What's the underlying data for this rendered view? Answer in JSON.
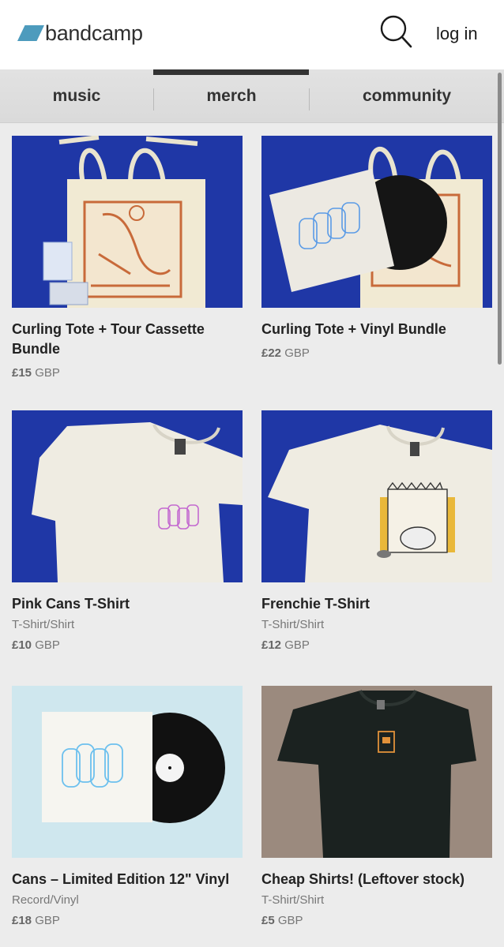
{
  "header": {
    "logo_text": "bandcamp",
    "search_icon": "search-icon",
    "login_label": "log in"
  },
  "tabs": [
    {
      "label": "music",
      "active": false
    },
    {
      "label": "merch",
      "active": true
    },
    {
      "label": "community",
      "active": false
    }
  ],
  "colors": {
    "brand": "#4d9bbd",
    "header_bg": "#ffffff",
    "tabs_bg": "#dedede",
    "page_bg": "#ececec",
    "thumb_blue": "#1e36a8"
  },
  "items": [
    {
      "title": "Curling Tote + Tour Cassette Bundle",
      "type": "",
      "price_amount": "£15",
      "price_currency": "GBP"
    },
    {
      "title": "Curling Tote + Vinyl Bundle",
      "type": "",
      "price_amount": "£22",
      "price_currency": "GBP"
    },
    {
      "title": "Pink Cans T-Shirt",
      "type": "T-Shirt/Shirt",
      "price_amount": "£10",
      "price_currency": "GBP"
    },
    {
      "title": "Frenchie T-Shirt",
      "type": "T-Shirt/Shirt",
      "price_amount": "£12",
      "price_currency": "GBP"
    },
    {
      "title": "Cans – Limited Edition 12\" Vinyl",
      "type": "Record/Vinyl",
      "price_amount": "£18",
      "price_currency": "GBP"
    },
    {
      "title": "Cheap Shirts! (Leftover stock)",
      "type": "T-Shirt/Shirt",
      "price_amount": "£5",
      "price_currency": "GBP"
    }
  ]
}
